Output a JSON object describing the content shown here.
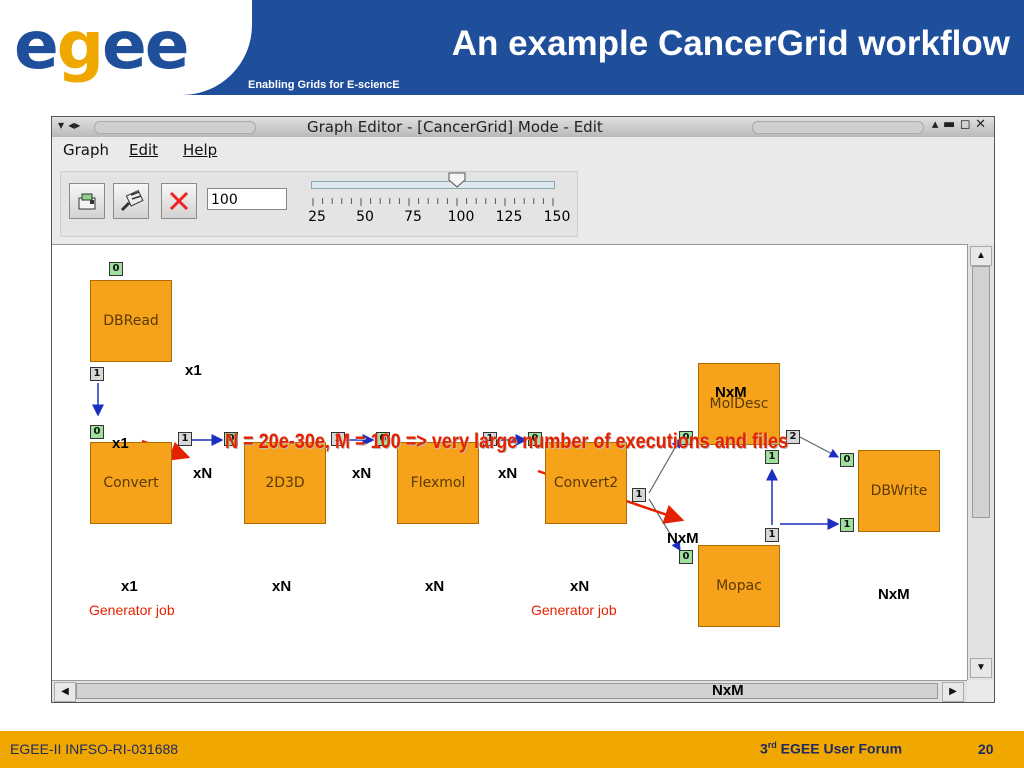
{
  "header": {
    "logo": [
      "e",
      "g",
      "e",
      "e"
    ],
    "title": "An example CancerGrid workflow",
    "tagline": "Enabling Grids for E-sciencE"
  },
  "window": {
    "title": "Graph Editor - [CancerGrid]  Mode - Edit",
    "left_controls": "▾ ◂▸",
    "right_controls": "▴ ▬ ◻ ✕"
  },
  "menu": [
    "Graph",
    "Edit",
    "Help"
  ],
  "toolbar": {
    "zoom_value": "100",
    "slider_value": 100,
    "slider_range": [
      25,
      150
    ],
    "tick_labels": [
      "25",
      "50",
      "75",
      "100",
      "125",
      "150"
    ]
  },
  "note": "N = 20e-30e, M = 100  => very large number of executions and files",
  "nodes": {
    "dbread": "DBRead",
    "convert": "Convert",
    "d2d3d": "2D3D",
    "flexmol": "Flexmol",
    "convert2": "Convert2",
    "moldesc": "MolDesc",
    "mopac": "Mopac",
    "dbwrite": "DBWrite"
  },
  "ports": {
    "dbread_in": "0",
    "dbread_out": "1",
    "convert_in": "0",
    "convert_out": "1",
    "d2d3d_in": "0",
    "d2d3d_out": "1",
    "flexmol_in": "0",
    "flexmol_out": "1",
    "convert2_in": "0",
    "convert2_out": "1",
    "moldesc_in": "0",
    "moldesc_out1": "1",
    "moldesc_out2": "2",
    "mopac_in": "0",
    "mopac_out": "1",
    "dbwrite_in0": "0",
    "dbwrite_in1": "1"
  },
  "annotations": {
    "dbread_x1": "x1",
    "convert_x1_top": "x1",
    "edge_xN_1": "xN",
    "edge_xN_2": "xN",
    "edge_xN_3": "xN",
    "moldesc_NxM": "NxM",
    "mopac_NxM": "NxM",
    "convert_x1": "x1",
    "d2d3d_xN": "xN",
    "flexmol_xN": "xN",
    "convert2_xN": "xN",
    "dbwrite_NxM": "NxM",
    "bottom_NxM": "NxM",
    "generator1": "Generator job",
    "generator2": "Generator job"
  },
  "footer": {
    "left": "EGEE-II INFSO-RI-031688",
    "ordinal_num": "3",
    "ordinal_sup": "rd",
    "event": " EGEE User Forum",
    "page": "20"
  },
  "colors": {
    "brand_blue": "#1f4e9a",
    "brand_orange": "#f0a800",
    "node_fill": "#f6a31b",
    "edge_blue": "#1a2fc0",
    "highlight_red": "#e52200"
  }
}
